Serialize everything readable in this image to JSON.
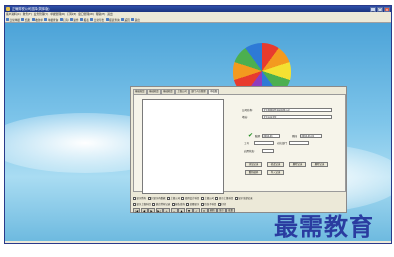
{
  "window": {
    "title": "正确财税公司选择(简体版)",
    "controls": [
      "_",
      "□",
      "×"
    ]
  },
  "menubar": [
    "客户资料(C)",
    "财务(F)",
    "业务管理(Y)",
    "单据管理(D)",
    "打印(P)",
    "窗口管理(W)",
    "帮助(H)",
    "退出"
  ],
  "toolbar": [
    "日常单据",
    "结账",
    "收款单",
    "单据查询",
    "打印",
    "复件",
    "报表",
    "日常导出",
    "报表查询",
    "返回",
    "退出"
  ],
  "dialog": {
    "tabs": [
      "基础档案",
      "基础档案",
      "基础档案",
      "上级公司",
      "部门人员管理",
      "审核图"
    ],
    "company_name_label": "公司名称:",
    "company_name_value": "北京财税软件科技有限公司",
    "address_label": "地址:",
    "address_value": "北京市海淀区",
    "date1_label": "账期",
    "date1_value": "2016-01",
    "date2_label": "期间",
    "date2_value": "2016-01-01",
    "worker_label": "工号",
    "dept_label": "对应部门",
    "rate_label": "启用状态:",
    "buttons_row1": [
      "添加记录",
      "修改记录",
      "删除记录",
      "删除记录"
    ],
    "buttons_row2": [
      "重新编码",
      "导入记录"
    ],
    "checkboxes_row1": [
      "显示所有",
      "只显示有数据",
      "上级公司",
      "使用会计科目",
      "上级公司",
      "显示上级科目",
      "显示全部记录"
    ],
    "checkboxes_row2": [
      "显示上级科目",
      "统计所有记录",
      "报告查询",
      "金额显示",
      "包含子科目",
      "打印"
    ],
    "navbar": [
      "|◀",
      "◀",
      "▶",
      "▶|",
      "+",
      "−",
      "▲",
      "▼",
      "✓",
      "✕"
    ],
    "navbar_text": [
      "刷新",
      "显示",
      "批量"
    ]
  },
  "watermark": "最需教育"
}
